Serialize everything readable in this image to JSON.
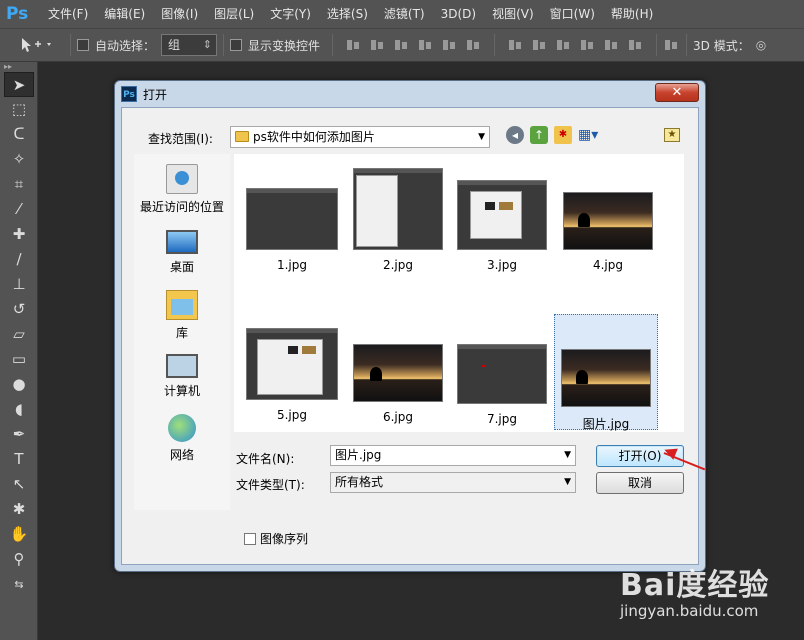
{
  "app": {
    "logo": "Ps",
    "menu": [
      "文件(F)",
      "编辑(E)",
      "图像(I)",
      "图层(L)",
      "文字(Y)",
      "选择(S)",
      "滤镜(T)",
      "3D(D)",
      "视图(V)",
      "窗口(W)",
      "帮助(H)"
    ]
  },
  "options": {
    "auto_select_label": "自动选择：",
    "auto_select_value": "组",
    "show_transform_label": "显示变换控件",
    "mode_3d_label": "3D 模式："
  },
  "dialog": {
    "icon": "Ps",
    "title": "打开",
    "close": "✕",
    "lookin_label": "查找范围(I):",
    "lookin_value": "ps软件中如何添加图片",
    "places": [
      "最近访问的位置",
      "桌面",
      "库",
      "计算机",
      "网络"
    ],
    "files": [
      "1.jpg",
      "2.jpg",
      "3.jpg",
      "4.jpg",
      "5.jpg",
      "6.jpg",
      "7.jpg",
      "图片.jpg"
    ],
    "selected_file": "图片.jpg",
    "filename_label": "文件名(N):",
    "filename_value": "图片.jpg",
    "filetype_label": "文件类型(T):",
    "filetype_value": "所有格式",
    "open_button": "打开(O)",
    "cancel_button": "取消",
    "image_sequence_label": "图像序列"
  },
  "watermark": {
    "logo": "Bai度经验",
    "url": "jingyan.baidu.com"
  },
  "colors": {
    "ps_blue": "#3fa9f5",
    "dialog_frame": "#c9d8e8",
    "selection": "#dbe9f9",
    "annotation_arrow": "#d81e1e"
  }
}
